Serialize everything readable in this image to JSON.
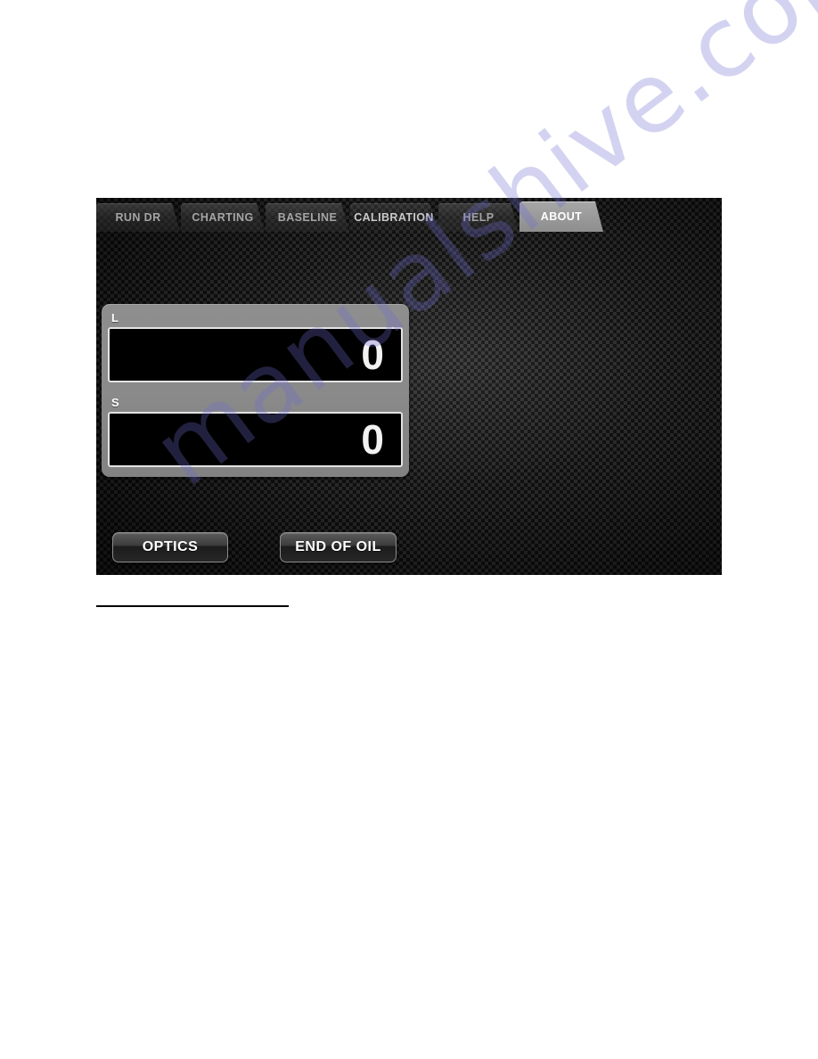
{
  "page": {
    "background_color": "#ffffff",
    "watermark": {
      "text": "manualshive.com",
      "color": "#6c6cd2"
    }
  },
  "device_screenshot": {
    "background_color": "#141414",
    "texture": "carbon-fiber-weave",
    "tabs": [
      {
        "id": "run-dr",
        "label": "RUN DR",
        "state": "inactive"
      },
      {
        "id": "charting",
        "label": "CHARTING",
        "state": "inactive"
      },
      {
        "id": "baseline",
        "label": "BASELINE",
        "state": "inactive"
      },
      {
        "id": "calibration",
        "label": "CALIBRATION",
        "state": "inactive"
      },
      {
        "id": "help",
        "label": "HELP",
        "state": "inactive"
      },
      {
        "id": "about",
        "label": "ABOUT",
        "state": "active"
      }
    ],
    "readouts": [
      {
        "id": "l",
        "label": "L",
        "value": "0"
      },
      {
        "id": "s",
        "label": "S",
        "value": "0"
      }
    ],
    "buttons": [
      {
        "id": "optics",
        "label": "OPTICS"
      },
      {
        "id": "end-of-oil",
        "label": "END OF OIL"
      }
    ],
    "colors": {
      "active_tab": "#9a9a9a",
      "inactive_tab": "#3b3b3b",
      "panel": "#8a8a8a",
      "field": "#000000",
      "field_border": "#e3e3e3",
      "value_text": "#f2f2f2",
      "button_text": "#ffffff"
    }
  }
}
